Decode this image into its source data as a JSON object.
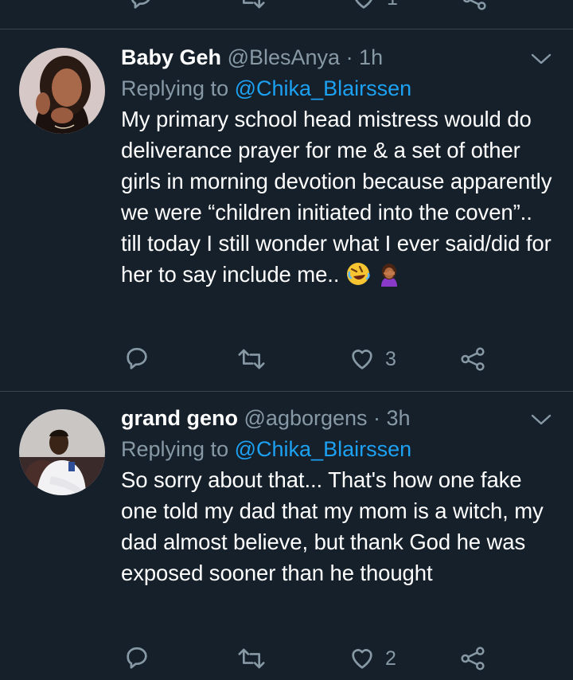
{
  "tweets": [
    {
      "name": "Baby Geh",
      "handle": "@BlesAnya",
      "time": "· 1h",
      "replying_prefix": "Replying to",
      "replying_to": "@Chika_Blairssen",
      "text": "My primary school head mistress would do deliverance prayer for me & a set of other girls in morning devotion because apparently we were “children initiated into the coven”.. till today I still wonder what I ever said/did for her to say include me..",
      "emojis": [
        "rolling-on-floor-laughing-emoji",
        "woman-facepalming-emoji"
      ],
      "like_count": "3",
      "retweet_count": "",
      "reply_count": ""
    },
    {
      "name": "grand geno",
      "handle": "@agborgens",
      "time": "· 3h",
      "replying_prefix": "Replying to",
      "replying_to": "@Chika_Blairssen",
      "text": "So sorry about that... That's how one fake one told my dad that my mom is a witch, my dad almost believe, but thank God he was exposed sooner than he thought",
      "like_count": "2",
      "retweet_count": "",
      "reply_count": ""
    }
  ],
  "previous_tweet": {
    "like_count": "1"
  },
  "colors": {
    "background": "#15202b",
    "secondary_text": "#8899a6",
    "link": "#1da1f2",
    "divider": "#38444d"
  }
}
